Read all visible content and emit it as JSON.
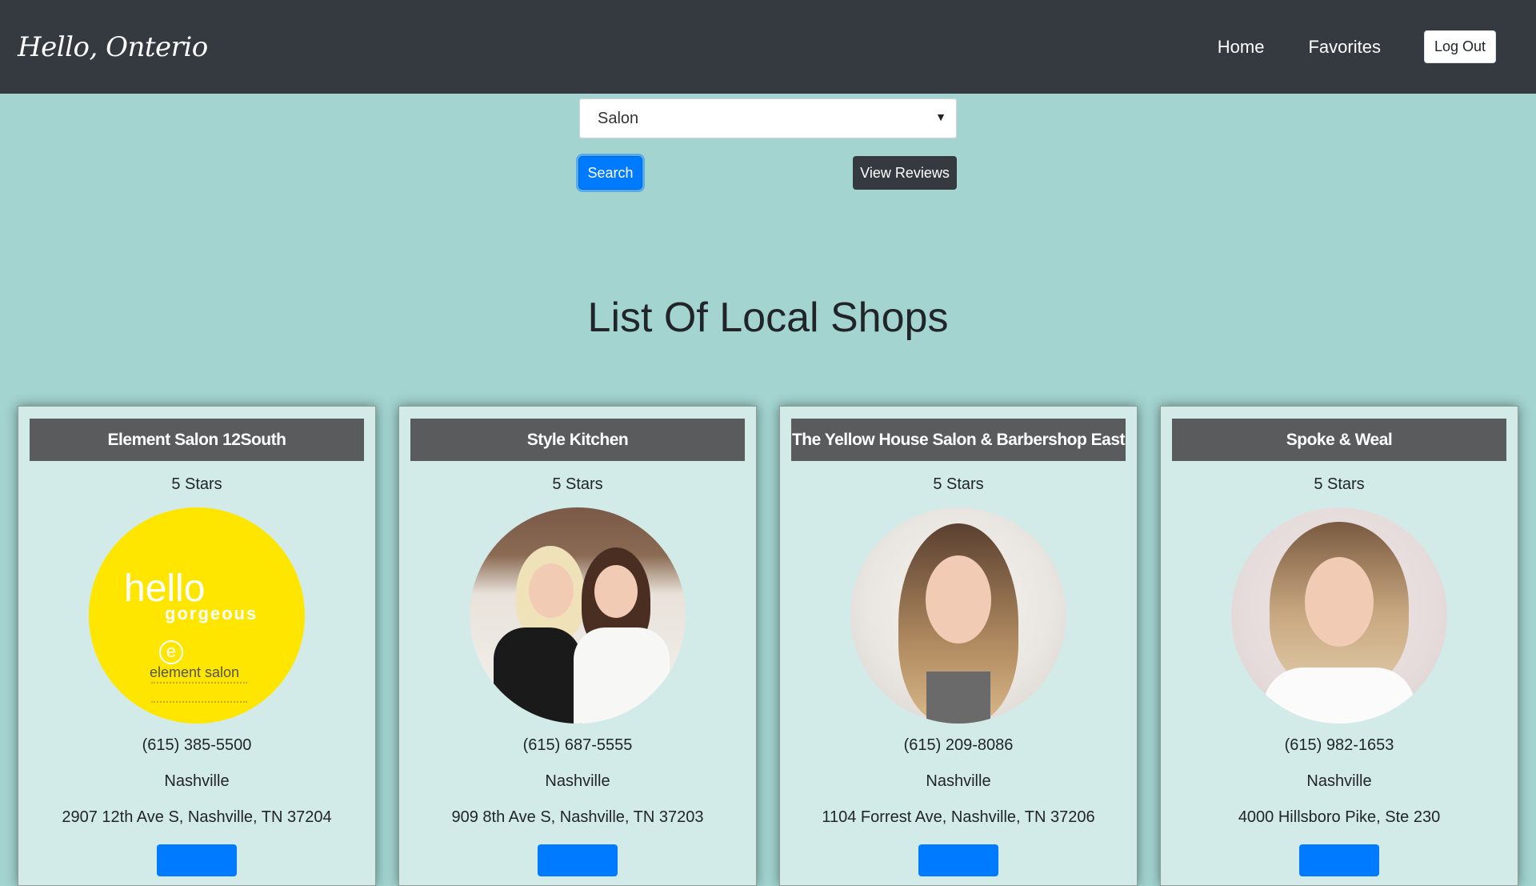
{
  "navbar": {
    "brand": "Hello, Onterio",
    "links": [
      "Home",
      "Favorites"
    ],
    "logout_label": "Log Out"
  },
  "controls": {
    "category_value": "Salon",
    "search_label": "Search",
    "reviews_label": "View Reviews"
  },
  "main": {
    "title": "List Of Local Shops"
  },
  "cards": [
    {
      "name": "Element Salon 12South",
      "rating": "5 Stars",
      "phone": "(615) 385-5500",
      "city": "Nashville",
      "address": "2907 12th Ave S, Nashville, TN 37204",
      "logo_text": {
        "line1": "hello",
        "line2": "gorgeous",
        "mark": "e",
        "brand": "element salon"
      }
    },
    {
      "name": "Style Kitchen",
      "rating": "5 Stars",
      "phone": "(615) 687-5555",
      "city": "Nashville",
      "address": "909 8th Ave S, Nashville, TN 37203"
    },
    {
      "name": "The Yellow House Salon & Barbershop East",
      "rating": "5 Stars",
      "phone": "(615) 209-8086",
      "city": "Nashville",
      "address": "1104 Forrest Ave, Nashville, TN 37206"
    },
    {
      "name": "Spoke & Weal",
      "rating": "5 Stars",
      "phone": "(615) 982-1653",
      "city": "Nashville",
      "address": "4000 Hillsboro Pike, Ste 230"
    }
  ],
  "colors": {
    "background": "#a3d4d0",
    "navbar": "#343a40",
    "primary": "#007bff",
    "card": "#d2ebe9",
    "card_header": "#5a5b5d"
  }
}
